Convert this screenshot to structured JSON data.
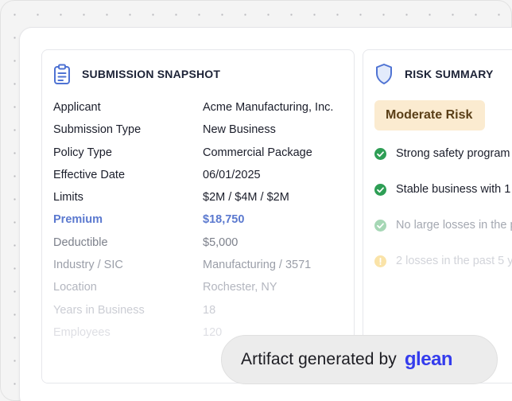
{
  "snapshot": {
    "title": "SUBMISSION SNAPSHOT",
    "icon": "clipboard-icon",
    "rows": [
      {
        "label": "Applicant",
        "value": "Acme Manufacturing, Inc."
      },
      {
        "label": "Submission Type",
        "value": "New Business"
      },
      {
        "label": "Policy Type",
        "value": "Commercial Package"
      },
      {
        "label": "Effective Date",
        "value": "06/01/2025"
      },
      {
        "label": "Limits",
        "value": "$2M / $4M / $2M"
      },
      {
        "label": "Premium",
        "value": "$18,750"
      },
      {
        "label": "Deductible",
        "value": "$5,000"
      },
      {
        "label": "Industry / SIC",
        "value": "Manufacturing / 3571"
      },
      {
        "label": "Location",
        "value": "Rochester, NY"
      },
      {
        "label": "Years in Business",
        "value": "18"
      },
      {
        "label": "Employees",
        "value": "120"
      }
    ]
  },
  "risk": {
    "title": "RISK SUMMARY",
    "icon": "shield-icon",
    "badge": "Moderate Risk",
    "items": [
      {
        "text": "Strong safety program",
        "status": "positive"
      },
      {
        "text": "Stable business with 1",
        "status": "positive"
      },
      {
        "text": "No large losses in the p",
        "status": "positive"
      },
      {
        "text": "2 losses in the past 5 y",
        "status": "warning"
      }
    ]
  },
  "footer": {
    "text": "Artifact generated by",
    "brand": "glean"
  },
  "colors": {
    "accent": "#5b79cf",
    "positive": "#2e9e55",
    "warning": "#f0b429",
    "badge_bg": "#fbebd0",
    "brand": "#343ced"
  }
}
